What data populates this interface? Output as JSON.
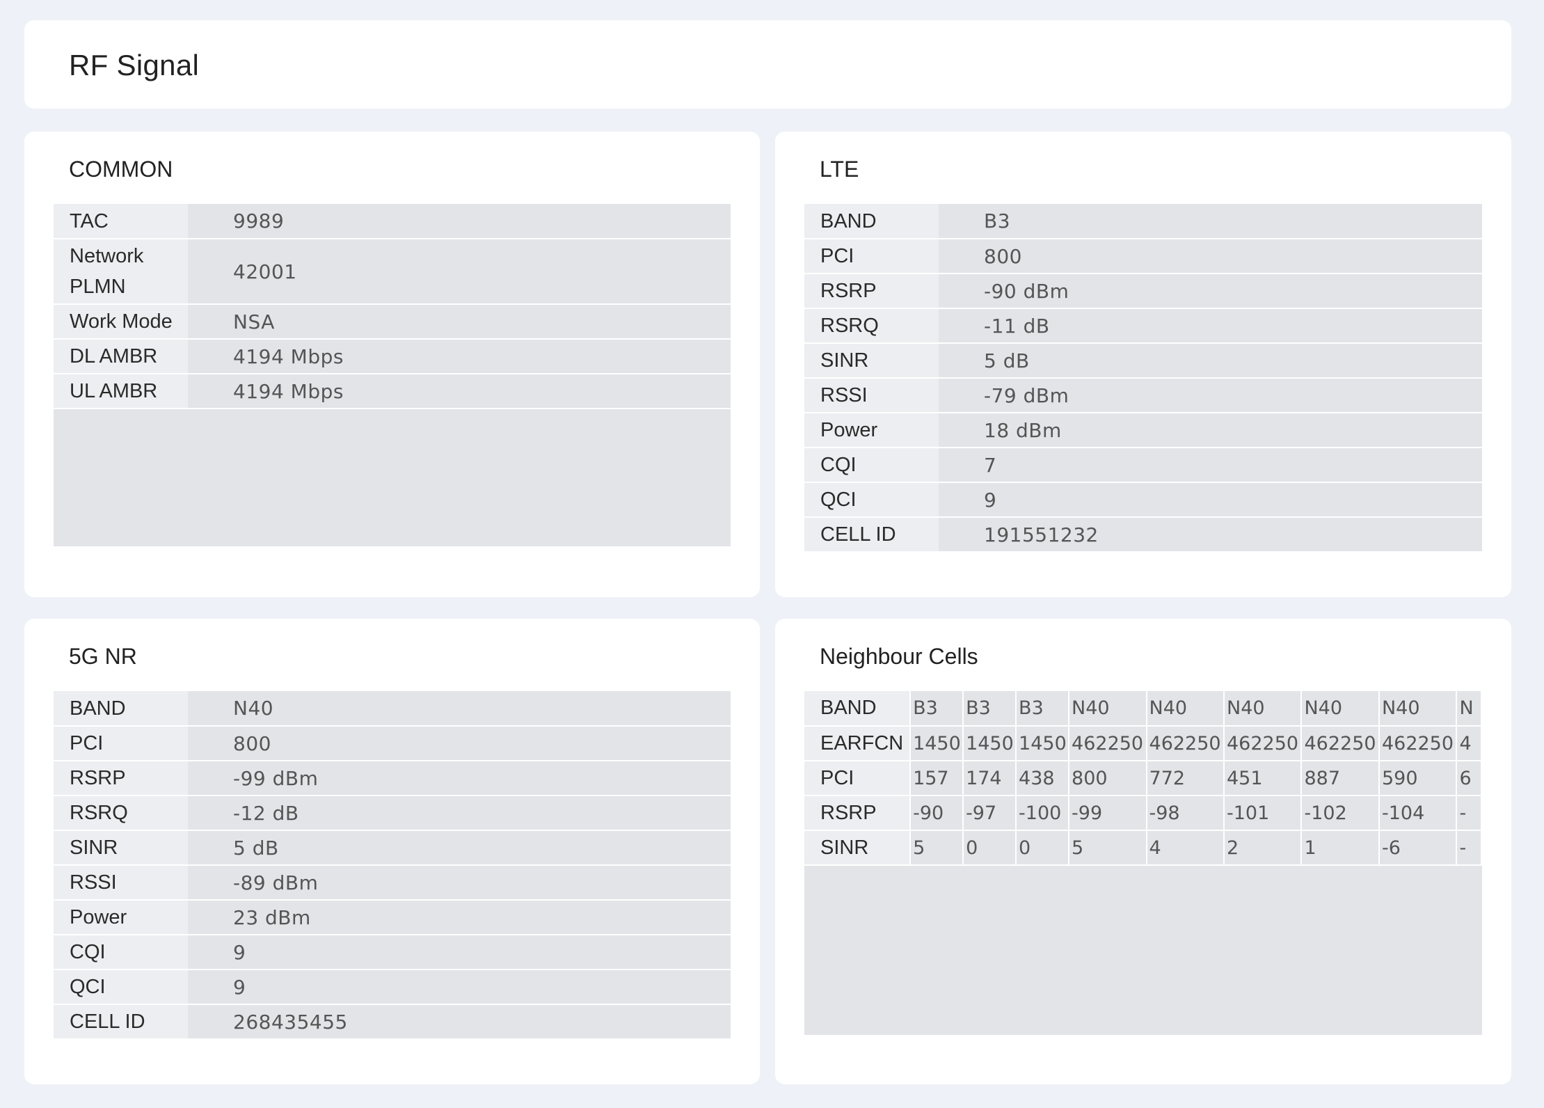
{
  "page": {
    "title": "RF Signal"
  },
  "common": {
    "title": "COMMON",
    "rows": [
      {
        "label": "TAC",
        "value": "9989"
      },
      {
        "label": "Network PLMN",
        "value": "42001"
      },
      {
        "label": "Work Mode",
        "value": "NSA"
      },
      {
        "label": "DL AMBR",
        "value": "4194 Mbps"
      },
      {
        "label": "UL AMBR",
        "value": "4194 Mbps"
      }
    ]
  },
  "lte": {
    "title": "LTE",
    "rows": [
      {
        "label": "BAND",
        "value": "B3"
      },
      {
        "label": "PCI",
        "value": "800"
      },
      {
        "label": "RSRP",
        "value": "-90 dBm"
      },
      {
        "label": "RSRQ",
        "value": "-11 dB"
      },
      {
        "label": "SINR",
        "value": "5 dB"
      },
      {
        "label": "RSSI",
        "value": "-79 dBm"
      },
      {
        "label": "Power",
        "value": "18 dBm"
      },
      {
        "label": "CQI",
        "value": "7"
      },
      {
        "label": "QCI",
        "value": "9"
      },
      {
        "label": "CELL ID",
        "value": "191551232"
      }
    ]
  },
  "nr": {
    "title": "5G NR",
    "rows": [
      {
        "label": "BAND",
        "value": "N40"
      },
      {
        "label": "PCI",
        "value": "800"
      },
      {
        "label": "RSRP",
        "value": "-99 dBm"
      },
      {
        "label": "RSRQ",
        "value": "-12 dB"
      },
      {
        "label": "SINR",
        "value": "5 dB"
      },
      {
        "label": "RSSI",
        "value": "-89 dBm"
      },
      {
        "label": "Power",
        "value": "23 dBm"
      },
      {
        "label": "CQI",
        "value": "9"
      },
      {
        "label": "QCI",
        "value": "9"
      },
      {
        "label": "CELL ID",
        "value": "268435455"
      }
    ]
  },
  "neighbour": {
    "title": "Neighbour Cells",
    "rows": [
      {
        "label": "BAND",
        "values": [
          "B3",
          "B3",
          "B3",
          "N40",
          "N40",
          "N40",
          "N40",
          "N40",
          "N"
        ]
      },
      {
        "label": "EARFCN",
        "values": [
          "1450",
          "1450",
          "1450",
          "462250",
          "462250",
          "462250",
          "462250",
          "462250",
          "4"
        ]
      },
      {
        "label": "PCI",
        "values": [
          "157",
          "174",
          "438",
          "800",
          "772",
          "451",
          "887",
          "590",
          "6"
        ]
      },
      {
        "label": "RSRP",
        "values": [
          "-90",
          "-97",
          "-100",
          "-99",
          "-98",
          "-101",
          "-102",
          "-104",
          "-"
        ]
      },
      {
        "label": "SINR",
        "values": [
          "5",
          "0",
          "0",
          "5",
          "4",
          "2",
          "1",
          "-6",
          "-"
        ]
      }
    ]
  }
}
